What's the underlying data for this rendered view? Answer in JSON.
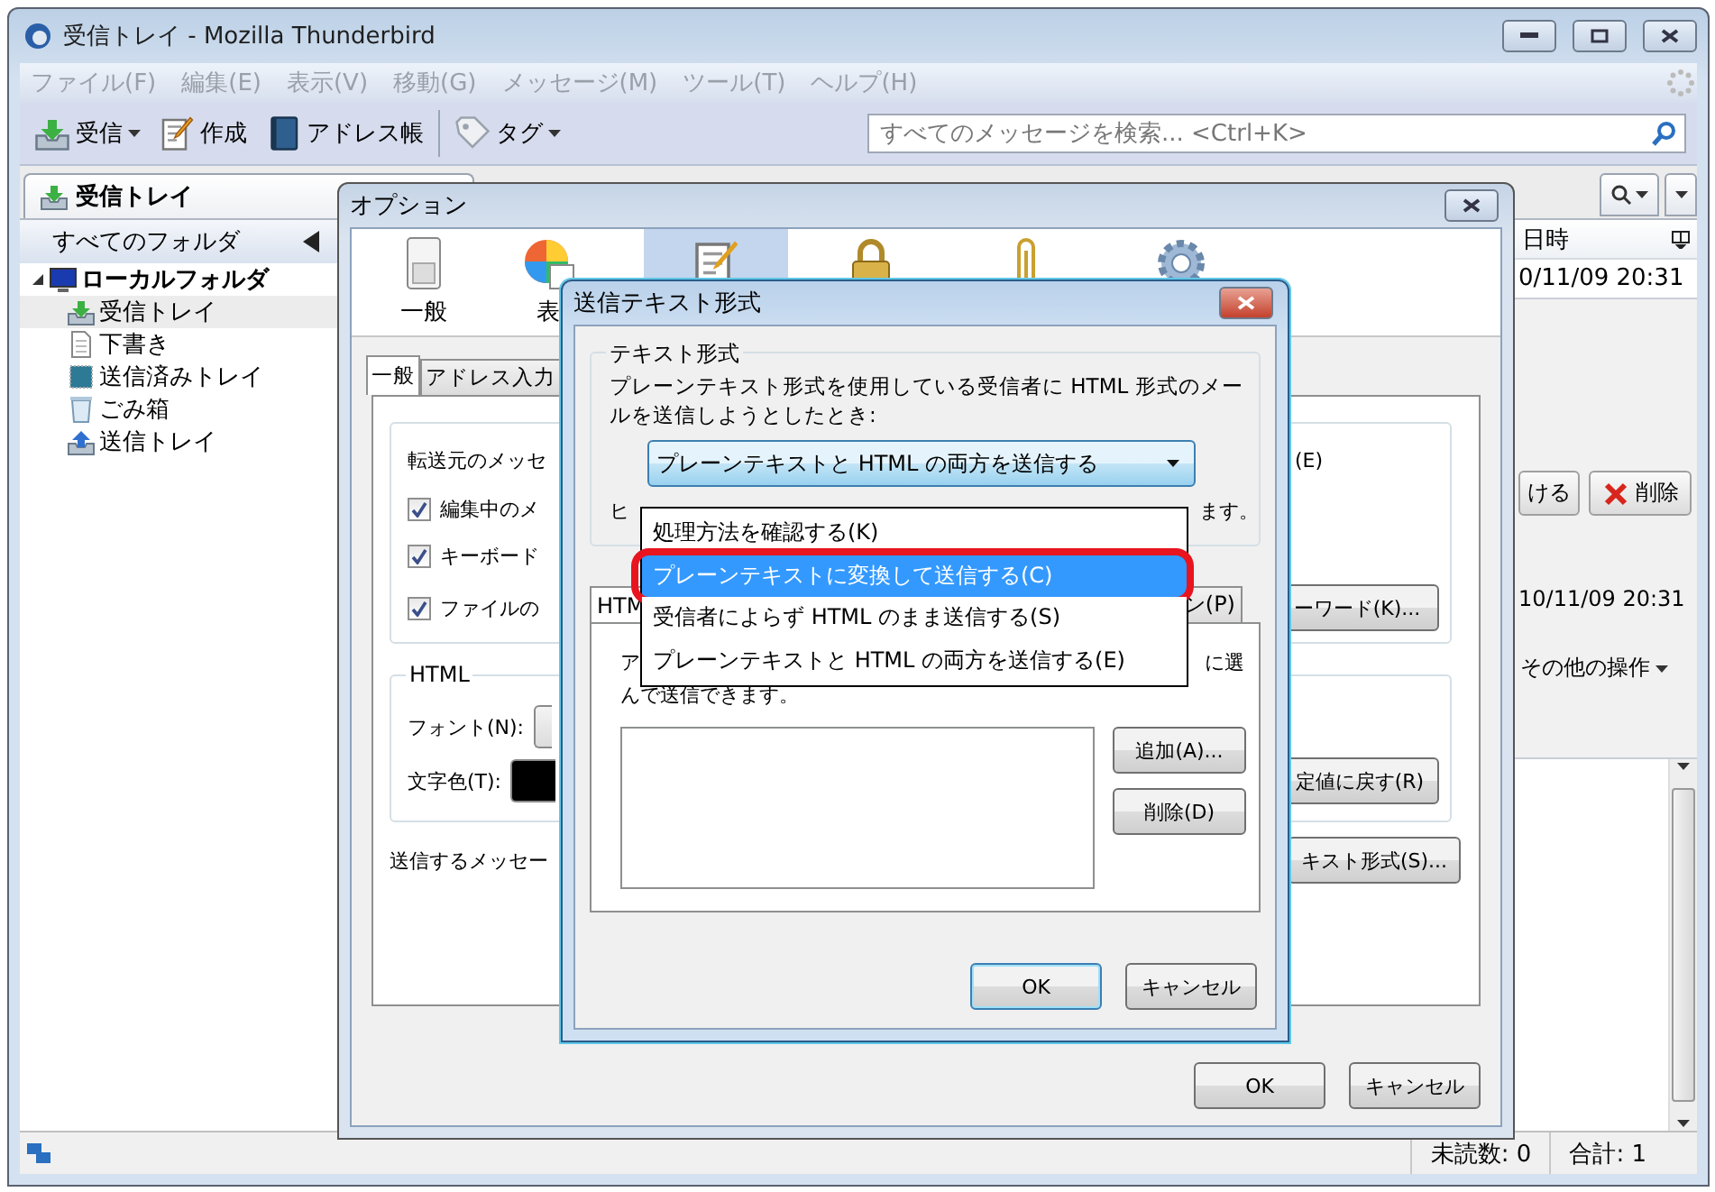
{
  "window": {
    "title": "受信トレイ - Mozilla Thunderbird"
  },
  "menu": [
    {
      "label": "ファイル(F)",
      "disabled": true
    },
    {
      "label": "編集(E)",
      "disabled": true
    },
    {
      "label": "表示(V)",
      "disabled": true
    },
    {
      "label": "移動(G)",
      "disabled": true
    },
    {
      "label": "メッセージ(M)",
      "disabled": true
    },
    {
      "label": "ツール(T)",
      "disabled": true
    },
    {
      "label": "ヘルプ(H)",
      "disabled": true
    }
  ],
  "toolbar": [
    {
      "label": "受信",
      "kind": "inbox",
      "dropdown": true
    },
    {
      "label": "作成",
      "kind": "compose",
      "dropdown": false
    },
    {
      "label": "アドレス帳",
      "kind": "book",
      "dropdown": false
    },
    {
      "label": "タグ",
      "kind": "tag",
      "dropdown": true
    }
  ],
  "search": {
    "placeholder": "すべてのメッセージを検索... <Ctrl+K>"
  },
  "tabs": [
    {
      "label": "受信トレイ",
      "selected": true
    }
  ],
  "folder_pane": {
    "header": "すべてのフォルダ",
    "tree": [
      {
        "label": "ローカルフォルダ",
        "kind": "computer",
        "expanded": true,
        "selected": false,
        "children": [
          {
            "label": "受信トレイ",
            "kind": "inbox",
            "selected": true
          },
          {
            "label": "下書き",
            "kind": "draft",
            "selected": false
          },
          {
            "label": "送信済みトレイ",
            "kind": "sent",
            "selected": false
          },
          {
            "label": "ごみ箱",
            "kind": "trash",
            "selected": false
          },
          {
            "label": "送信トレイ",
            "kind": "outbox",
            "selected": false
          }
        ]
      }
    ]
  },
  "message_list": {
    "column_header": "日時",
    "rows": [
      {
        "date": "0/11/09 20:31"
      }
    ]
  },
  "message_header": {
    "buttons": [
      {
        "label": "ける",
        "kind": "plain"
      },
      {
        "label": "削除",
        "kind": "delete"
      }
    ],
    "date": "10/11/09 20:31",
    "more": "その他の操作"
  },
  "status_bar": {
    "unread": "未読数: 0",
    "total": "合計: 1"
  },
  "options": {
    "title": "オプション",
    "panes": [
      {
        "label": "一般",
        "kind": "switch",
        "selected": false
      },
      {
        "label": "表",
        "kind": "palette",
        "selected": false
      },
      {
        "kind": "compose",
        "selected": true
      },
      {
        "kind": "lock",
        "selected": false
      },
      {
        "kind": "clip",
        "selected": false
      },
      {
        "kind": "gear",
        "selected": false
      }
    ],
    "tabs": [
      {
        "label": "一般",
        "selected": true
      },
      {
        "label": "アドレス入力",
        "selected": false
      }
    ],
    "forward_label": "転送元のメッセ",
    "forward_right": "(E)",
    "checkboxes": [
      {
        "label": "編集中のメ",
        "checked": true
      },
      {
        "label": "キーボード",
        "checked": true
      },
      {
        "label": "ファイルの",
        "checked": true
      }
    ],
    "keyword_button": "ーワード(K)...",
    "html_group": {
      "title": "HTML",
      "font_label": "フォント(N):",
      "color_label": "文字色(T):",
      "reset_button": "定値に戻す(R)"
    },
    "send_label": "送信するメッセー",
    "send_format_button": "キスト形式(S)...",
    "buttons": [
      "OK",
      "キャンセル"
    ]
  },
  "text_format_dialog": {
    "title": "送信テキスト形式",
    "group_title": "テキスト形式",
    "description": "プレーンテキスト形式を使用している受信者に HTML 形式のメールを送信しようとしたとき:",
    "select_value": "プレーンテキストと HTML の両方を送信する",
    "hint_start": "ヒ",
    "hint_end": "ます。",
    "tabs": [
      {
        "label": "HTM",
        "selected": true
      },
      {
        "label": "ン(P)",
        "selected": false
      }
    ],
    "tab_text_start": "ア",
    "tab_text_end": "に選",
    "tab_text_line2": "んで送信できます。",
    "list_buttons": [
      "追加(A)...",
      "削除(D)"
    ],
    "buttons": [
      "OK",
      "キャンセル"
    ],
    "dropdown": {
      "options": [
        {
          "label": "処理方法を確認する(K)",
          "selected": false
        },
        {
          "label": "プレーンテキストに変換して送信する(C)",
          "selected": true
        },
        {
          "label": "受信者によらず HTML のまま送信する(S)",
          "selected": false
        },
        {
          "label": "プレーンテキストと HTML の両方を送信する(E)",
          "selected": false
        }
      ]
    }
  }
}
